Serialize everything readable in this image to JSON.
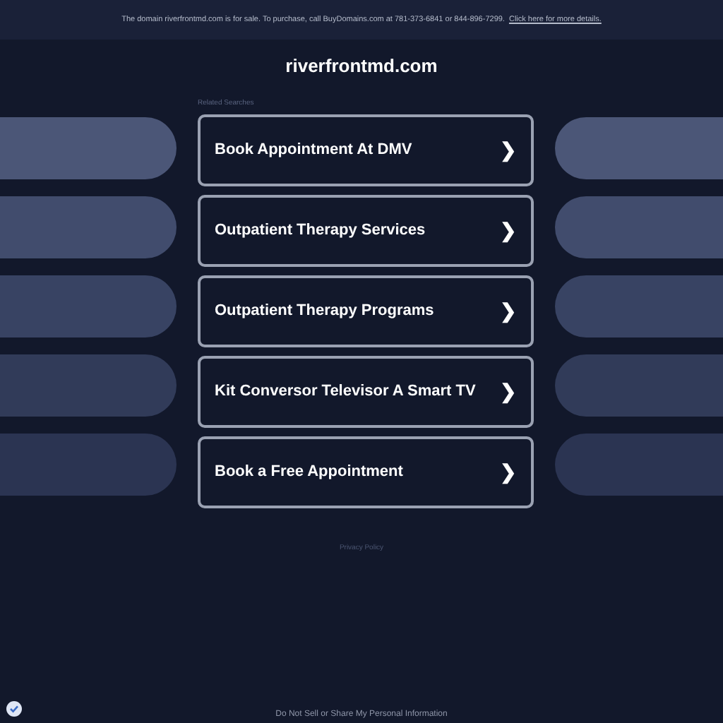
{
  "banner": {
    "text": "The domain riverfrontmd.com is for sale. To purchase, call BuyDomains.com at 781-373-6841 or 844-896-7299.",
    "link": "Click here for more details."
  },
  "domain_title": "riverfrontmd.com",
  "related_label": "Related Searches",
  "searches": [
    {
      "label": "Book Appointment At DMV",
      "chevron": "❯"
    },
    {
      "label": "Outpatient Therapy Services",
      "chevron": "❯"
    },
    {
      "label": "Outpatient Therapy Programs",
      "chevron": "❯"
    },
    {
      "label": "Kit Conversor Televisor A Smart TV",
      "chevron": "❯"
    },
    {
      "label": "Book a Free Appointment",
      "chevron": "❯"
    }
  ],
  "privacy_link": "Privacy Policy",
  "footer_link": "Do Not Sell or Share My Personal Information"
}
